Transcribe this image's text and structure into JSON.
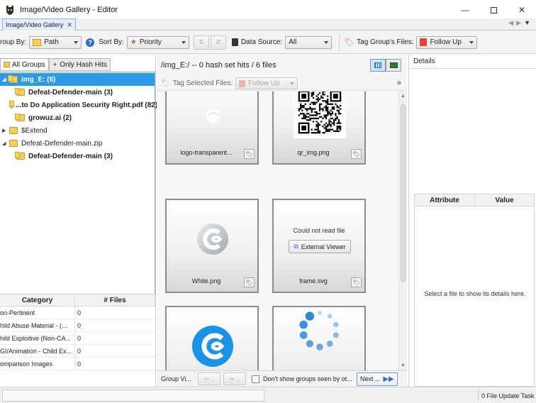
{
  "window": {
    "title": "Image/Video Gallery - Editor"
  },
  "tab": {
    "label": "Image/Video Gallery"
  },
  "toolbar": {
    "group_by_label": "roup By:",
    "group_by_value": "Path",
    "sort_by_label": "Sort By:",
    "sort_by_value": "Priority",
    "data_source_label": "Data Source:",
    "data_source_value": "All",
    "tag_group_label": "Tag Group's Files:",
    "tag_group_value": "Follow Up"
  },
  "left": {
    "tabs": [
      "All Groups",
      "Only Hash Hits"
    ],
    "tree": [
      {
        "label": "img_E: (6)",
        "indent": 0,
        "expander": "down",
        "selected": true,
        "bold": true,
        "folder": "hl"
      },
      {
        "label": "Defeat-Defender-main (3)",
        "indent": 1,
        "expander": "",
        "selected": false,
        "bold": true,
        "folder": "hl"
      },
      {
        "label": "...to Do Application Security Right.pdf (82)",
        "indent": 1,
        "expander": "",
        "selected": false,
        "bold": true,
        "folder": "hl"
      },
      {
        "label": "growuz.ai (2)",
        "indent": 1,
        "expander": "",
        "selected": false,
        "bold": true,
        "folder": "hl"
      },
      {
        "label": "$Extend",
        "indent": 0,
        "expander": "right",
        "selected": false,
        "bold": false,
        "folder": "plain"
      },
      {
        "label": "Defeat-Defender-main.zip",
        "indent": 0,
        "expander": "down",
        "selected": false,
        "bold": false,
        "folder": "plain"
      },
      {
        "label": "Defeat-Defender-main (3)",
        "indent": 1,
        "expander": "",
        "selected": false,
        "bold": true,
        "folder": "hl"
      }
    ],
    "category_headers": [
      "Category",
      "# Files"
    ],
    "categories": [
      {
        "name": "on-Pertinent",
        "count": "0"
      },
      {
        "name": "hild Abuse Material - (...",
        "count": "0"
      },
      {
        "name": "hild Exploitive (Non-CA...",
        "count": "0"
      },
      {
        "name": "GI/Animation - Child Ex...",
        "count": "0"
      },
      {
        "name": "omparison Images",
        "count": "0"
      }
    ]
  },
  "center": {
    "title": "/img_E:/ -- 0 hash set hits / 6 files",
    "tag_selected_label": "Tag Selected Files:",
    "tag_selected_value": "Follow Up",
    "tiles": [
      {
        "name": "logo-transparent...",
        "kind": "logo"
      },
      {
        "name": "qr_img.png",
        "kind": "qr"
      },
      {
        "name": "White.png",
        "kind": "white-logo"
      },
      {
        "name": "frame.svg",
        "kind": "error",
        "error_text": "Could not read file",
        "button": "External Viewer"
      },
      {
        "name": "",
        "kind": "blue-logo"
      },
      {
        "name": "",
        "kind": "spinner"
      }
    ],
    "footer": {
      "group_label": "Group Vi...",
      "checkbox_label": "Don't show groups seen by ot...",
      "next_label": "Next ..."
    }
  },
  "right": {
    "details_title": "Details",
    "attr_headers": [
      "Attribute",
      "Value"
    ],
    "empty_text": "Select a file to show its details here."
  },
  "status": {
    "right_text": "0 File Update Task"
  },
  "colors": {
    "selection": "#2a9be4",
    "accent": "#1e7fd0"
  }
}
